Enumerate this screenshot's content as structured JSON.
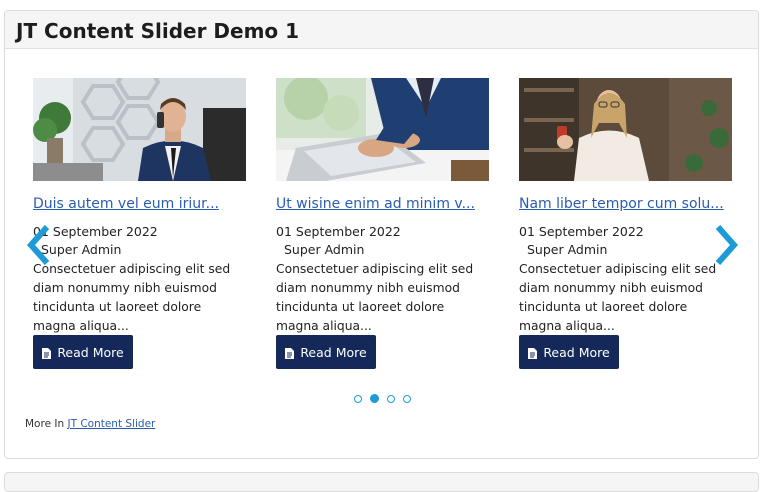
{
  "module": {
    "title": "JT Content Slider Demo 1"
  },
  "slides": [
    {
      "title": "Duis autem vel eum iriur...",
      "date": "01 September 2022",
      "author": "Super Admin",
      "text": "Consectetuer adipiscing elit sed diam nonummy nibh euismod tincidunta ut laoreet dolore magna aliqua...",
      "button_label": "Read More",
      "image": "businessman-on-phone-photo"
    },
    {
      "title": "Ut wisine enim ad minim v...",
      "date": "01 September 2022",
      "author": "Super Admin",
      "text": "Consectetuer adipiscing elit sed diam nonummy nibh euismod tincidunta ut laoreet dolore magna aliqua...",
      "button_label": "Read More",
      "image": "businessman-typing-laptop-photo"
    },
    {
      "title": "Nam liber tempor cum solu...",
      "date": "01 September 2022",
      "author": "Super Admin",
      "text": "Consectetuer adipiscing elit sed diam nonummy nibh euismod tincidunta ut laoreet dolore magna aliqua...",
      "button_label": "Read More",
      "image": "woman-with-smartphone-photo"
    }
  ],
  "pagination": {
    "count": 4,
    "active": 1
  },
  "footer": {
    "more_in_label": "More In",
    "more_in_link": "JT Content Slider"
  },
  "colors": {
    "accent": "#1e9bd7",
    "button_bg": "#14285a",
    "link": "#2a5db0"
  },
  "icons": {
    "prev": "chevron-left-icon",
    "next": "chevron-right-icon",
    "button": "document-icon"
  }
}
